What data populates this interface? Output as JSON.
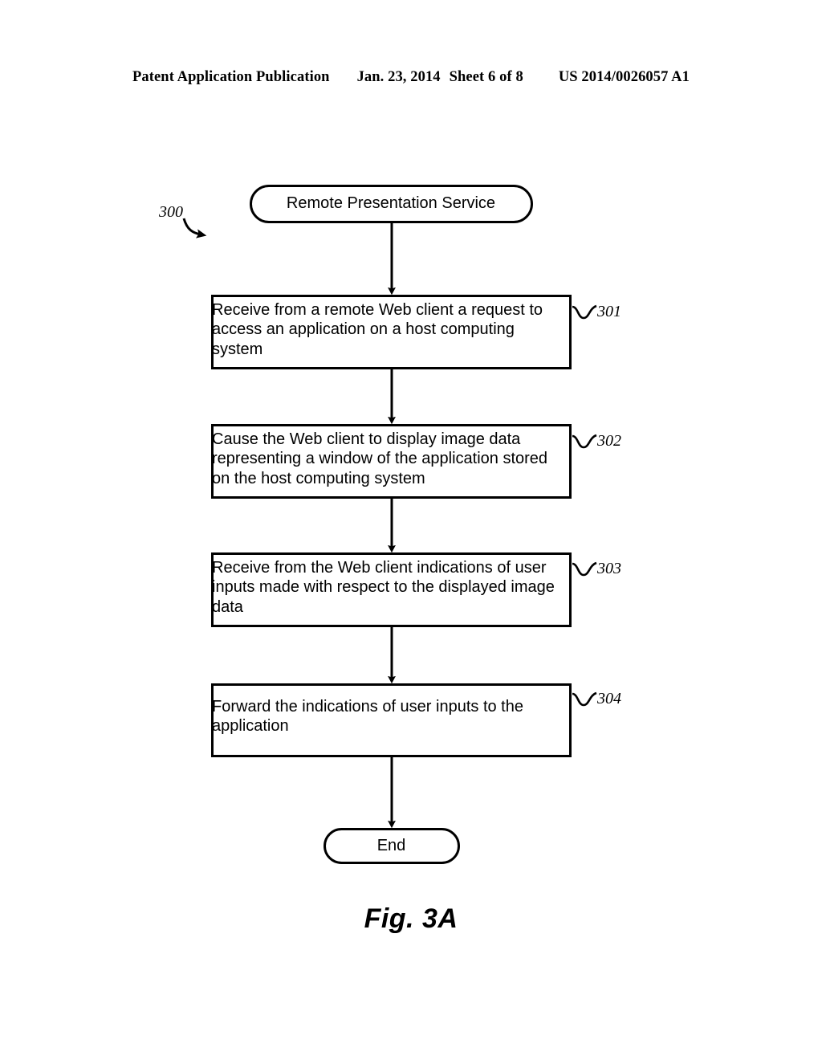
{
  "header": {
    "publication": "Patent Application Publication",
    "date": "Jan. 23, 2014",
    "sheet": "Sheet 6 of 8",
    "patent_number": "US 2014/0026057 A1"
  },
  "figure": {
    "caption": "Fig. 3A",
    "diagram_reference": "300"
  },
  "flowchart": {
    "start": {
      "label": "Remote Presentation Service",
      "shape": "rounded-terminator"
    },
    "end": {
      "label": "End",
      "shape": "stadium-terminator"
    },
    "steps": [
      {
        "ref": "301",
        "text": "Receive from a remote Web client a request to access an application on a host computing system"
      },
      {
        "ref": "302",
        "text": "Cause the Web client to display image data representing a window of the application stored on the host computing system"
      },
      {
        "ref": "303",
        "text": "Receive from the Web client indications of user inputs made with respect to the displayed image data"
      },
      {
        "ref": "304",
        "text": "Forward the indications of user inputs to the application"
      }
    ]
  },
  "colors": {
    "ink": "#000000",
    "paper": "#ffffff"
  }
}
